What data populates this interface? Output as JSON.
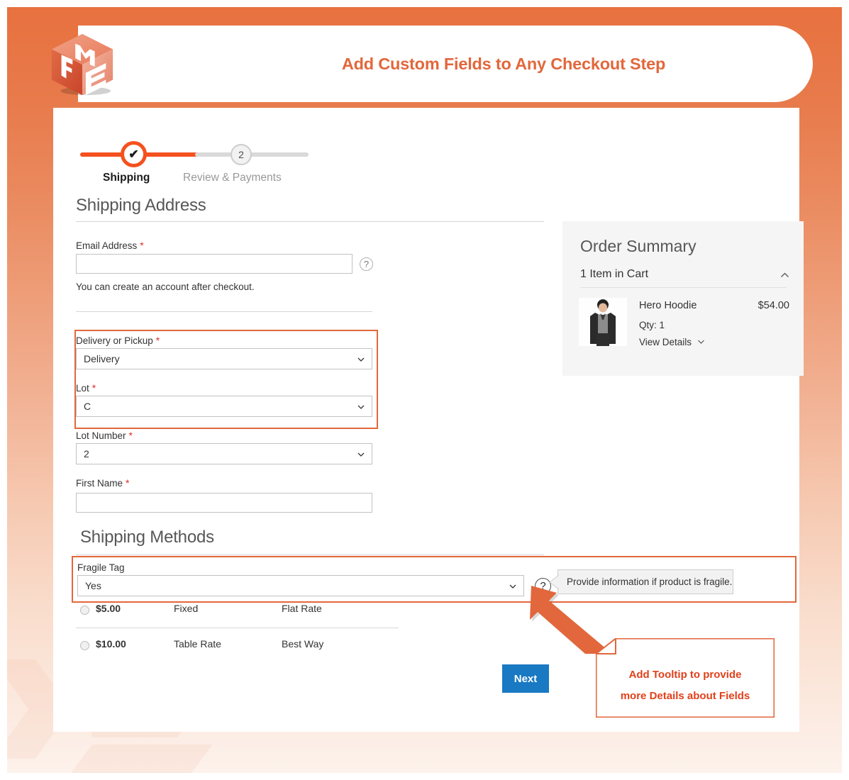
{
  "banner": {
    "title": "Add Custom Fields to Any Checkout Step",
    "logo_alt": "FME",
    "accent_color": "#e2673c",
    "bg_gradient_top": "#e8713f",
    "bg_gradient_bottom": "#fdf2ec"
  },
  "checkout": {
    "steps": [
      {
        "label": "Shipping",
        "state": "complete",
        "marker": "✔"
      },
      {
        "label": "Review & Payments",
        "state": "upcoming",
        "marker": "2"
      }
    ],
    "shipping_address": {
      "heading": "Shipping Address",
      "email": {
        "label": "Email Address",
        "required": "*",
        "value": "",
        "placeholder": "",
        "hint": "You can create an account after checkout.",
        "help_icon": "question-mark-icon"
      },
      "custom_fields": [
        {
          "label": "Delivery or Pickup",
          "required": "*",
          "value": "Delivery",
          "type": "select"
        },
        {
          "label": "Lot",
          "required": "*",
          "value": "C",
          "type": "select"
        },
        {
          "label": "Lot Number",
          "required": "*",
          "value": "2",
          "type": "select"
        }
      ],
      "first_name": {
        "label": "First Name",
        "required": "*",
        "value": ""
      }
    },
    "shipping_methods": {
      "heading": "Shipping Methods",
      "fragile_field": {
        "label": "Fragile Tag",
        "value": "Yes",
        "type": "select",
        "help_icon": "question-mark-icon",
        "tooltip": "Provide information if product is fragile."
      },
      "rows": [
        {
          "price": "$5.00",
          "carrier": "Fixed",
          "method": "Flat Rate",
          "selected": false
        },
        {
          "price": "$10.00",
          "carrier": "Table Rate",
          "method": "Best Way",
          "selected": false
        }
      ]
    },
    "next_button": "Next"
  },
  "order_summary": {
    "title": "Order Summary",
    "items_in_cart": "1 Item in Cart",
    "collapse_icon": "chevron-up-icon",
    "item": {
      "name": "Hero Hoodie",
      "price": "$54.00",
      "qty": "Qty: 1",
      "view_details": "View Details",
      "view_details_icon": "chevron-down-icon"
    }
  },
  "annotation": {
    "line1": "Add Tooltip to provide",
    "line2": "more Details about Fields",
    "color": "#e2401b",
    "arrow": "arrow-up-left-icon"
  }
}
